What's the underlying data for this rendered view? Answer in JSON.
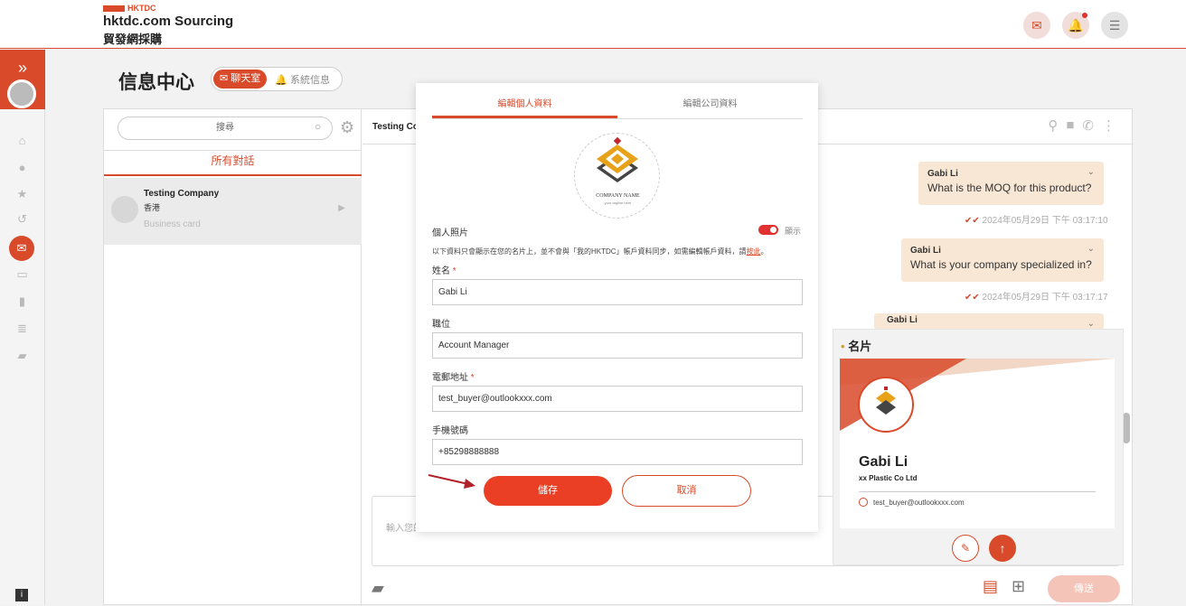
{
  "header": {
    "brand_small": "HKTDC",
    "brand_title": "hktdc.com Sourcing",
    "brand_subtitle": "貿發網採購",
    "icons": [
      "mail-icon",
      "bell-icon",
      "menu-icon"
    ]
  },
  "page": {
    "title": "信息中心",
    "tab_chat": "聊天室",
    "tab_system": "系統信息"
  },
  "conversations": {
    "search_placeholder": "搜尋",
    "filter": "所有對話",
    "items": [
      {
        "name": "Testing Company",
        "location": "香港",
        "preview": "Business card"
      }
    ]
  },
  "chat": {
    "header_name": "Testing Co",
    "messages": [
      {
        "sender": "Gabi Li",
        "text": "What is the MOQ for this product?",
        "time": "2024年05月29日 下午 03:17:10"
      },
      {
        "sender": "Gabi Li",
        "text": "What is your company specialized in?",
        "time": "2024年05月29日 下午 03:17:17"
      },
      {
        "sender": "Gabi Li"
      }
    ],
    "compose_placeholder": "輸入您的",
    "send_label": "傳送"
  },
  "business_card": {
    "title": "名片",
    "name": "Gabi Li",
    "company": "xx Plastic Co Ltd",
    "email": "test_buyer@outlookxxx.com"
  },
  "modal": {
    "tab_personal": "編輯個人資料",
    "tab_company": "編輯公司資料",
    "logo_company_name": "COMPANY NAME",
    "logo_tagline": "your tagline here",
    "photo_label": "個人照片",
    "show_label": "顯示",
    "note_text": "以下資料只會顯示在您的名片上，並不會與「我的HKTDC」帳戶資料同步，如需編輯帳戶資料，請",
    "note_link": "按此",
    "note_end": "。",
    "name_label": "姓名",
    "name_value": "Gabi Li",
    "position_label": "職位",
    "position_value": "Account Manager",
    "email_label": "電郵地址",
    "email_value": "test_buyer@outlookxxx.com",
    "phone_label": "手機號碼",
    "phone_value": "+85298888888",
    "required_mark": "*",
    "save_label": "儲存",
    "cancel_label": "取消"
  },
  "colors": {
    "accent": "#d84a2a",
    "bubble": "#f8e7d5"
  }
}
